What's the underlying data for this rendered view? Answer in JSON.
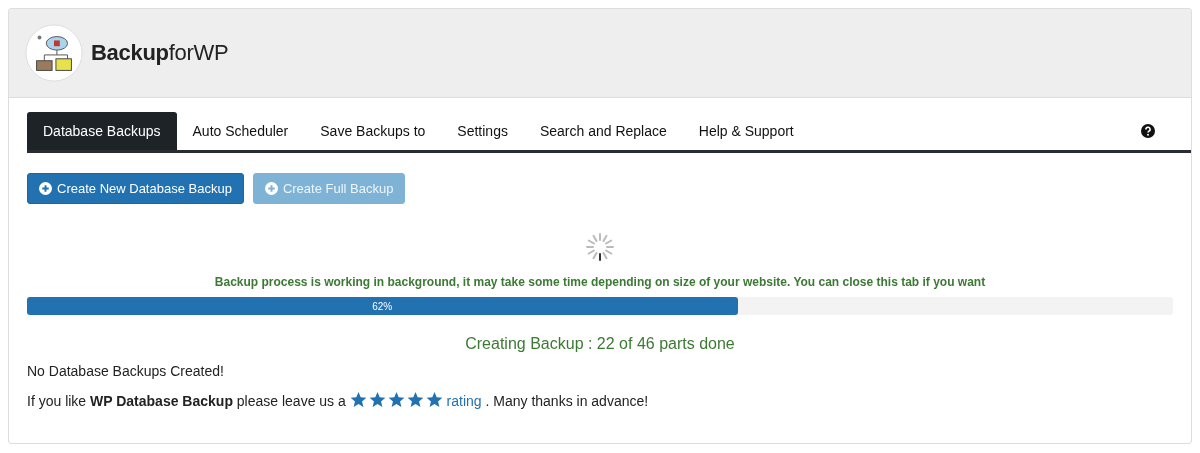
{
  "header": {
    "logo_text": "**Backup**forWP"
  },
  "tabs": [
    {
      "label": "Database Backups",
      "selected": true
    },
    {
      "label": "Auto Scheduler",
      "selected": false
    },
    {
      "label": "Save Backups to",
      "selected": false
    },
    {
      "label": "Settings",
      "selected": false
    },
    {
      "label": "Search and Replace",
      "selected": false
    },
    {
      "label": "Help & Support",
      "selected": false
    }
  ],
  "buttons": [
    {
      "label": "Create New Database Backup",
      "disabled": false
    },
    {
      "label": "Create Full Backup",
      "disabled": true
    }
  ],
  "progress": {
    "message": "Backup process is working in background, it may take some time depending on size of your website. You can close this tab if you want",
    "level": 0.62,
    "label": "62%",
    "status": "Creating Backup : 22 of 46 parts done"
  },
  "empty_message": "No Database Backups Created!",
  "rating": {
    "before": "If you like **WP Database Backup** please leave us a",
    "stars": 5,
    "link": "rating",
    "after": ". Many thanks in advance!"
  }
}
